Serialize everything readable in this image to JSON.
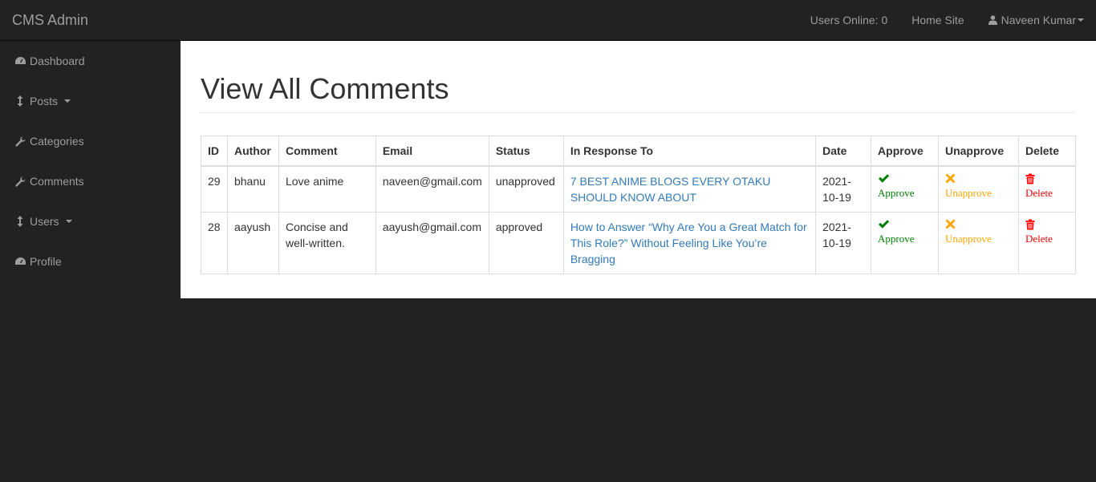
{
  "navbar": {
    "brand": "CMS Admin",
    "users_online": "Users Online: 0",
    "home_site": "Home Site",
    "user_name": "Naveen Kumar"
  },
  "sidebar": {
    "items": [
      {
        "label": "Dashboard",
        "icon": "dashboard-icon"
      },
      {
        "label": "Posts",
        "icon": "arrows-v-icon"
      },
      {
        "label": "Categories",
        "icon": "wrench-icon"
      },
      {
        "label": "Comments",
        "icon": "wrench-icon"
      },
      {
        "label": "Users",
        "icon": "arrows-v-icon"
      },
      {
        "label": "Profile",
        "icon": "dashboard-icon"
      }
    ]
  },
  "main": {
    "title": "View All Comments",
    "table": {
      "headers": [
        "ID",
        "Author",
        "Comment",
        "Email",
        "Status",
        "In Response To",
        "Date",
        "Approve",
        "Unapprove",
        "Delete"
      ],
      "rows": [
        {
          "id": "29",
          "author": "bhanu",
          "comment": "Love anime",
          "email": "naveen@gmail.com",
          "status": "unapproved",
          "response": "7 BEST ANIME BLOGS EVERY OTAKU SHOULD KNOW ABOUT",
          "date": "2021-10-19",
          "approve": "Approve",
          "unapprove": "Unapprove",
          "delete": "Delete"
        },
        {
          "id": "28",
          "author": "aayush",
          "comment": "Concise and well-written.",
          "email": "aayush@gmail.com",
          "status": "approved",
          "response": "How to Answer “Why Are You a Great Match for This Role?” Without Feeling Like You’re Bragging",
          "date": "2021-10-19",
          "approve": "Approve",
          "unapprove": "Unapprove",
          "delete": "Delete"
        }
      ]
    }
  },
  "colors": {
    "approve": "#008000",
    "unapprove": "#ffa500",
    "delete": "#ff0000",
    "link": "#337ab7",
    "nav_bg": "#222222",
    "nav_text": "#9d9d9d"
  }
}
